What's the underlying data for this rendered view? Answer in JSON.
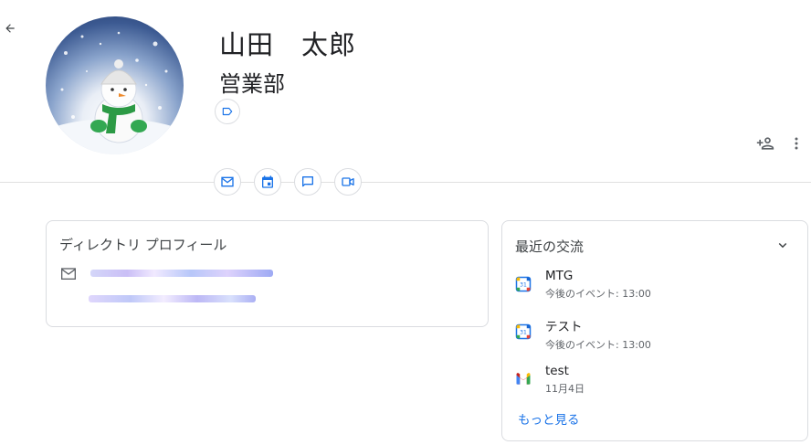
{
  "profile": {
    "name": "山田　太郎",
    "department": "営業部"
  },
  "icons": {
    "back": "arrow-back-icon",
    "label": "label-icon",
    "add_person": "person-add-icon",
    "more": "more-vert-icon",
    "email": "mail-icon",
    "calendar": "calendar-icon",
    "chat": "chat-icon",
    "video": "video-icon"
  },
  "directory": {
    "title": "ディレクトリ プロフィール"
  },
  "interactions": {
    "title": "最近の交流",
    "items": [
      {
        "icon": "google-calendar-icon",
        "title": "MTG",
        "subtitle": "今後のイベント: 13:00"
      },
      {
        "icon": "google-calendar-icon",
        "title": "テスト",
        "subtitle": "今後のイベント: 13:00"
      },
      {
        "icon": "gmail-icon",
        "title": "test",
        "subtitle": "11月4日"
      }
    ],
    "more_label": "もっと見る"
  },
  "colors": {
    "accent": "#1a73e8",
    "divider": "#e0e0e0",
    "border": "#dadce0"
  }
}
